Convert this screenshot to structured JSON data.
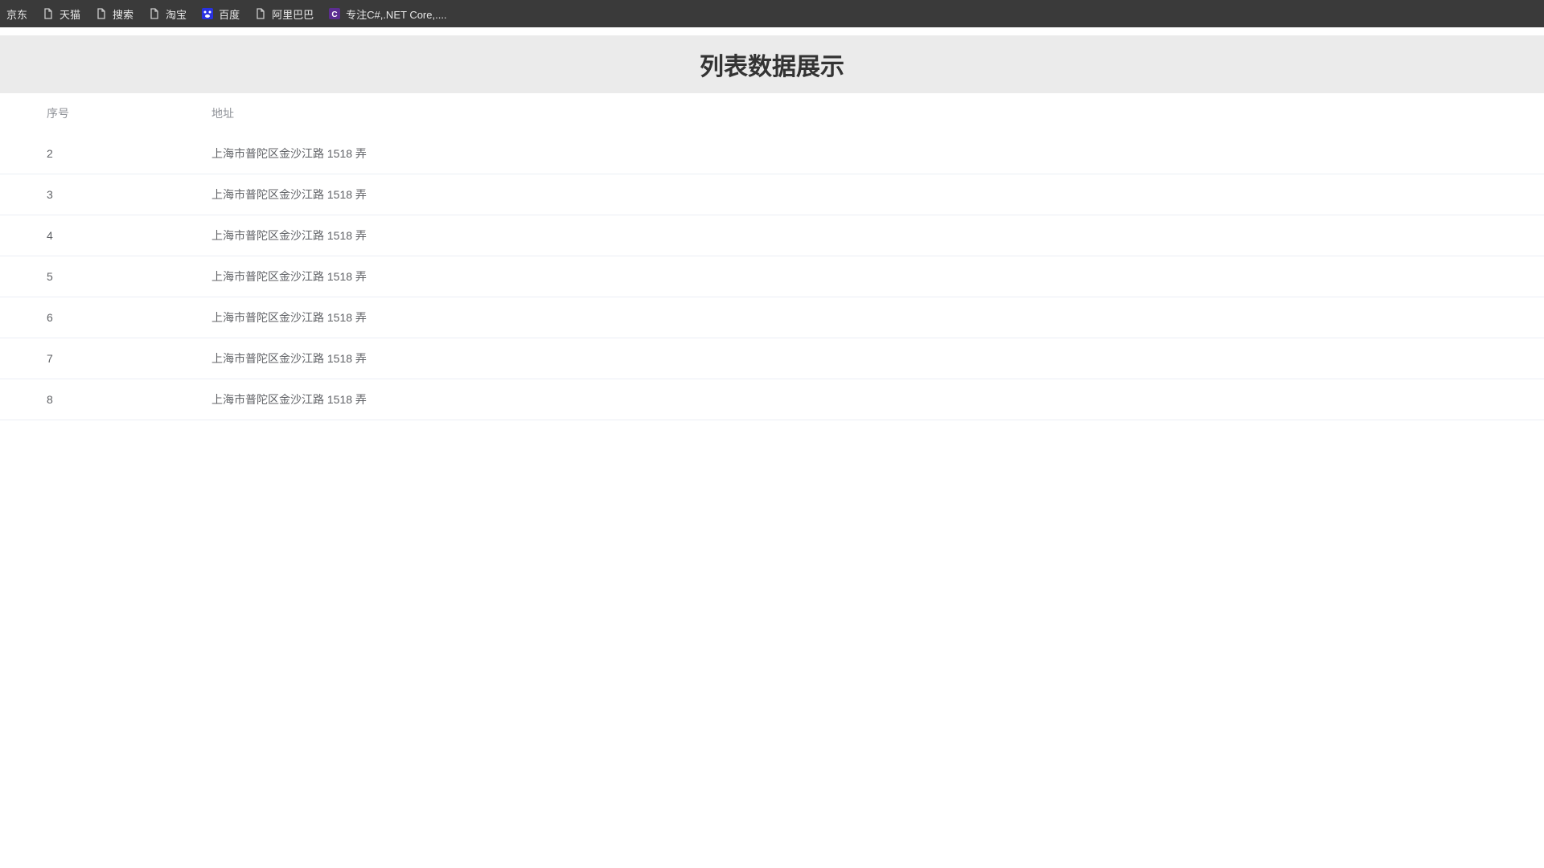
{
  "bookmarks": [
    {
      "label": "京东",
      "icon": "none"
    },
    {
      "label": "天猫",
      "icon": "doc"
    },
    {
      "label": "搜索",
      "icon": "doc"
    },
    {
      "label": "淘宝",
      "icon": "doc"
    },
    {
      "label": "百度",
      "icon": "baidu"
    },
    {
      "label": "阿里巴巴",
      "icon": "doc"
    },
    {
      "label": "专注C#,.NET Core,....",
      "icon": "csharp"
    }
  ],
  "page": {
    "title": "列表数据展示"
  },
  "table": {
    "headers": {
      "index": "序号",
      "address": "地址"
    },
    "rows": [
      {
        "index": "2",
        "address": "上海市普陀区金沙江路 1518 弄"
      },
      {
        "index": "3",
        "address": "上海市普陀区金沙江路 1518 弄"
      },
      {
        "index": "4",
        "address": "上海市普陀区金沙江路 1518 弄"
      },
      {
        "index": "5",
        "address": "上海市普陀区金沙江路 1518 弄"
      },
      {
        "index": "6",
        "address": "上海市普陀区金沙江路 1518 弄"
      },
      {
        "index": "7",
        "address": "上海市普陀区金沙江路 1518 弄"
      },
      {
        "index": "8",
        "address": "上海市普陀区金沙江路 1518 弄"
      }
    ]
  }
}
